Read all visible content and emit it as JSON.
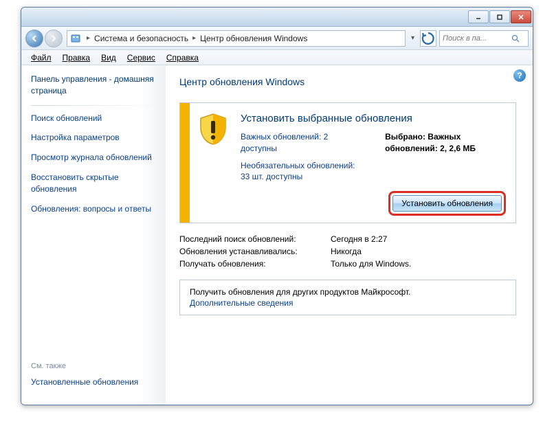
{
  "titlebar": {
    "min": "minimize",
    "max": "maximize",
    "close": "close"
  },
  "breadcrumb": {
    "seg1": "Система и безопасность",
    "seg2": "Центр обновления Windows"
  },
  "search": {
    "placeholder": "Поиск в па..."
  },
  "menu": {
    "file": "Файл",
    "edit": "Правка",
    "view": "Вид",
    "tools": "Сервис",
    "help": "Справка"
  },
  "sidebar": {
    "home": "Панель управления - домашняя страница",
    "links": [
      "Поиск обновлений",
      "Настройка параметров",
      "Просмотр журнала обновлений",
      "Восстановить скрытые обновления",
      "Обновления: вопросы и ответы"
    ],
    "see_also": "См. также",
    "installed": "Установленные обновления"
  },
  "main": {
    "heading": "Центр обновления Windows",
    "box": {
      "title": "Установить выбранные обновления",
      "important": "Важных обновлений: 2 доступны",
      "optional": "Необязательных обновлений: 33 шт. доступны",
      "selected_label": "Выбрано: Важных обновлений: 2, 2,6 МБ",
      "install_btn": "Установить обновления"
    },
    "info": [
      {
        "label": "Последний поиск обновлений:",
        "value": "Сегодня в 2:27"
      },
      {
        "label": "Обновления устанавливались:",
        "value": "Никогда"
      },
      {
        "label": "Получать обновления:",
        "value": "Только для Windows."
      }
    ],
    "promo": {
      "text": "Получить обновления для других продуктов Майкрософт.",
      "link": "Дополнительные сведения"
    }
  }
}
